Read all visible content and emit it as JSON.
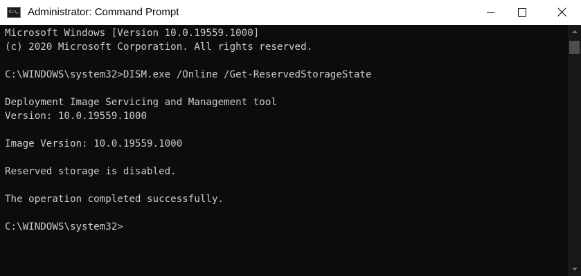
{
  "window": {
    "title": "Administrator: Command Prompt",
    "icon": "cmd-icon",
    "icon_text": "C:\\."
  },
  "caption_buttons": {
    "minimize": "minimize-icon",
    "maximize": "maximize-icon",
    "close": "close-icon"
  },
  "console": {
    "lines": [
      "Microsoft Windows [Version 10.0.19559.1000]",
      "(c) 2020 Microsoft Corporation. All rights reserved.",
      "C:\\WINDOWS\\system32>DISM.exe /Online /Get-ReservedStorageState",
      "Deployment Image Servicing and Management tool",
      "Version: 10.0.19559.1000",
      "Image Version: 10.0.19559.1000",
      "Reserved storage is disabled.",
      "The operation completed successfully.",
      "C:\\WINDOWS\\system32>"
    ]
  },
  "colors": {
    "console_background": "#0c0c0c",
    "console_text": "#cccccc",
    "titlebar_background": "#ffffff"
  }
}
